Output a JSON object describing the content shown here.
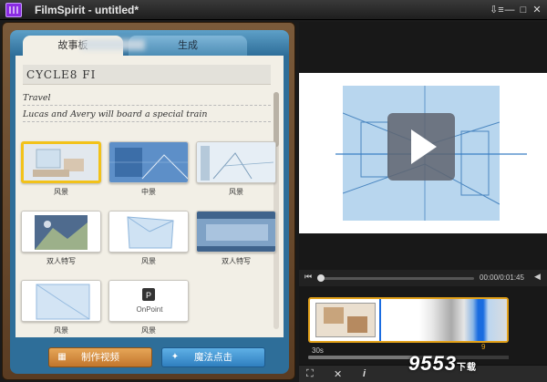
{
  "window": {
    "title": "FilmSpirit - untitled*",
    "controls": [
      "⇩≡",
      "—",
      "□",
      "✕"
    ]
  },
  "left": {
    "tabs": [
      "故事板",
      "生成"
    ],
    "project_title": "CYCLE8 FI",
    "notes": [
      "Travel",
      "Lucas and Avery will board a special train"
    ],
    "shots": [
      {
        "label": "风景",
        "selected": true
      },
      {
        "label": "中景",
        "selected": false
      },
      {
        "label": "风景",
        "selected": false
      },
      {
        "label": "双人特写",
        "selected": false
      },
      {
        "label": "风景",
        "selected": false
      },
      {
        "label": "双人特写",
        "selected": false
      },
      {
        "label": "风景",
        "selected": false
      },
      {
        "label": "风景",
        "selected": false
      }
    ],
    "buttons": {
      "make_video": "制作视频",
      "magic_click": "魔法点击"
    }
  },
  "player": {
    "timecode": "00:00/0:01:45",
    "timeline_start": "30s",
    "timeline_marker": "9"
  },
  "watermark": {
    "text": "9553",
    "sub": "下载"
  }
}
